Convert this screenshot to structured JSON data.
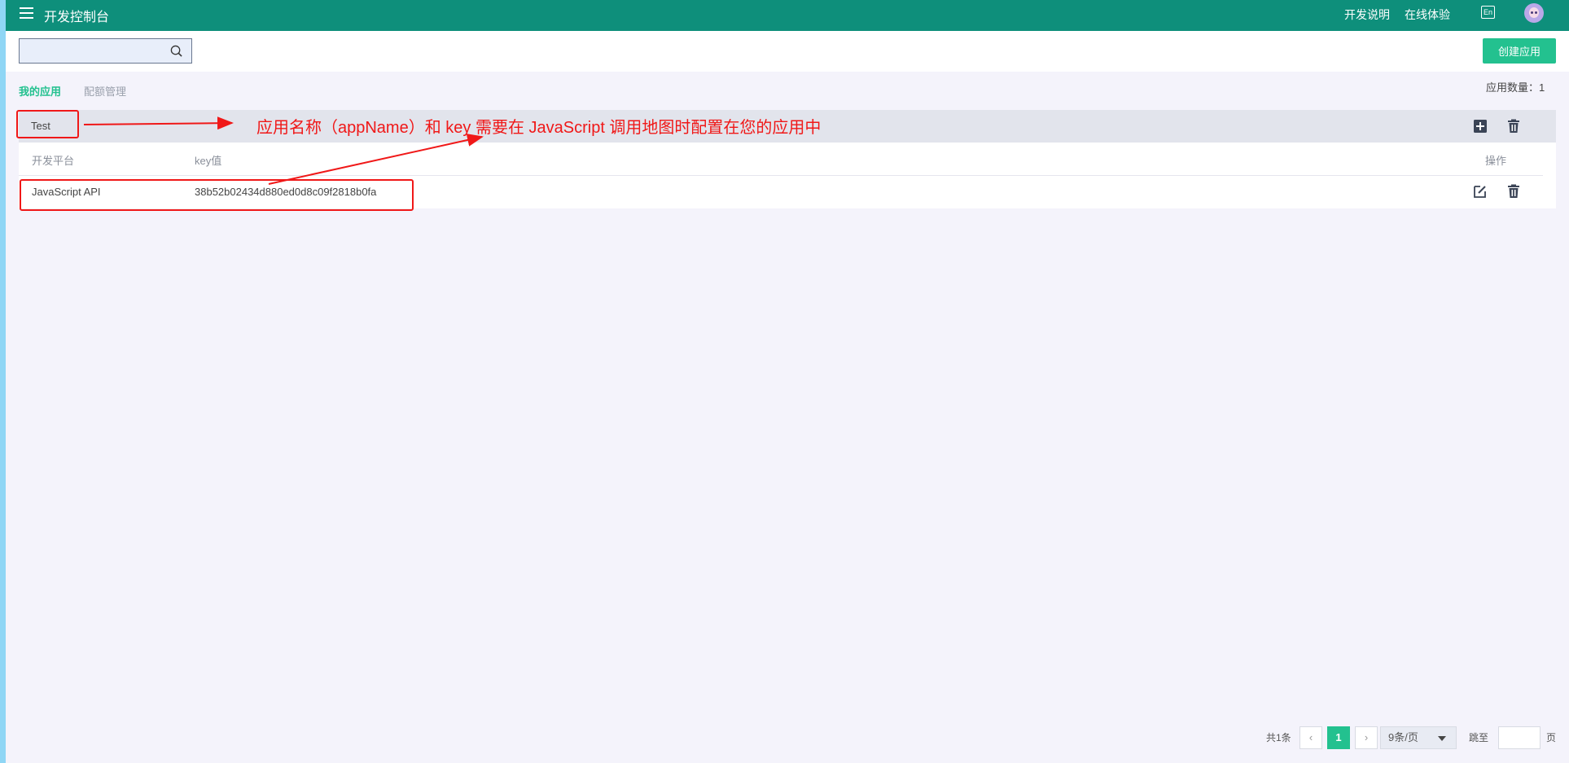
{
  "topbar": {
    "title": "开发控制台",
    "nav": [
      "开发说明",
      "在线体验"
    ],
    "lang_label": "En",
    "menu_icon": "hamburger-menu-icon",
    "avatar_icon": "user-avatar-icon"
  },
  "toolbar": {
    "search_placeholder": "",
    "search_value": "",
    "create_label": "创建应用"
  },
  "tabs": [
    {
      "label": "我的应用",
      "active": true
    },
    {
      "label": "配额管理",
      "active": false
    }
  ],
  "app_count_label": "应用数量：1",
  "app": {
    "name": "Test",
    "columns": {
      "platform": "开发平台",
      "key": "key值",
      "actions": "操作"
    },
    "rows": [
      {
        "platform": "JavaScript API",
        "key": "38b52b02434d880ed0d8c09f2818b0fa"
      }
    ]
  },
  "annotation": {
    "text": "应用名称（appName）和 key 需要在 JavaScript 调用地图时配置在您的应用中",
    "color": "#f01818"
  },
  "pagination": {
    "total_label": "共1条",
    "prev": "‹",
    "current_page": "1",
    "next": "›",
    "page_size_label": "9条/页",
    "jump_label": "跳至",
    "page_suffix": "页"
  },
  "colors": {
    "header": "#0e8f7b",
    "accent": "#23c18f"
  }
}
